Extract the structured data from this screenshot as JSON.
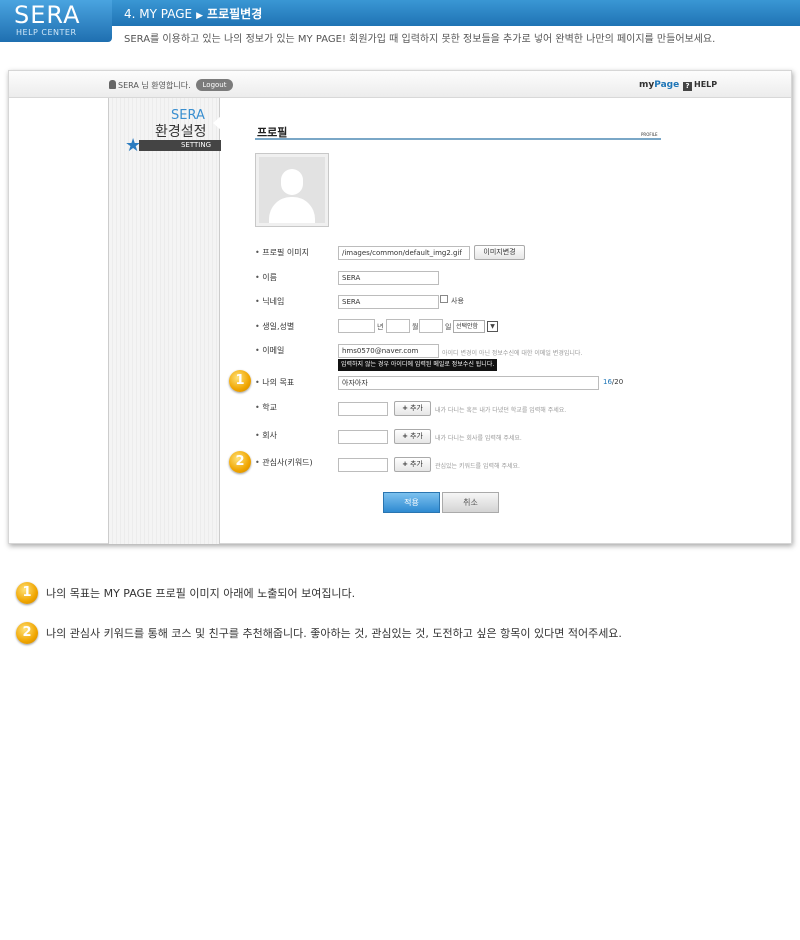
{
  "header": {
    "logo": "SERA",
    "logo_sub": "HELP CENTER",
    "crumb_section": "4. MY PAGE",
    "crumb_page": "프로필변경",
    "description": "SERA를 이용하고 있는 나의 정보가 있는 MY PAGE!  회원가입 때 입력하지 못한 정보들을 추가로 넣어 완벽한 나만의 페이지를 만들어보세요."
  },
  "topnav": {
    "welcome": "SERA 님 환영합니다.",
    "logout_label": "Logout",
    "mypage_prefix": "my",
    "mypage_suffix": "Page",
    "help_label": "HELP"
  },
  "sidebar": {
    "brand": "SERA",
    "title": "환경설정",
    "subtitle": "SETTING"
  },
  "content": {
    "title": "프로필",
    "title_small": "PROFILE"
  },
  "form": {
    "profile_image": {
      "label": "프로필 이미지",
      "value": "/images/common/default_img2.gif",
      "button": "이미지변경"
    },
    "name": {
      "label": "이름",
      "value": "SERA"
    },
    "nickname": {
      "label": "닉네임",
      "value": "SERA",
      "checkbox_label": "사용"
    },
    "birth": {
      "label": "생일,성별",
      "year_unit": "년",
      "month_unit": "월",
      "day_unit": "일",
      "gender_select": "선택안함"
    },
    "email": {
      "label": "이메일",
      "value": "hms0570@naver.com",
      "hint": "아이디 변경이 아닌 정보수신에 대한 이메일 변경입니다.",
      "tooltip": "입력하지 않는 경우 아이디에 입력된 메일로 정보수신 됩니다."
    },
    "goal": {
      "label": "나의 목표",
      "value": "아자아자",
      "count_current": "16",
      "count_max": "/20"
    },
    "school": {
      "label": "학교",
      "button": "추가",
      "hint": "내가 다니는 혹은 내가 다녔던 학교를 입력해 주세요."
    },
    "company": {
      "label": "회사",
      "button": "추가",
      "hint": "내가 다니는 회사를 입력해 주세요."
    },
    "interest": {
      "label": "관심사(키워드)",
      "button": "추가",
      "hint": "관심있는 키워드를 입력해 주세요."
    },
    "apply_label": "적용",
    "cancel_label": "취소"
  },
  "markers": [
    "1",
    "2"
  ],
  "notes": [
    {
      "num": "1",
      "text": "나의 목표는 MY PAGE 프로필 이미지 아래에 노출되어 보여집니다."
    },
    {
      "num": "2",
      "text": "나의 관심사 키워드를 통해 코스 및 친구를 추천해줍니다. 좋아하는 것, 관심있는 것, 도전하고 싶은 항목이 있다면 적어주세요."
    }
  ]
}
